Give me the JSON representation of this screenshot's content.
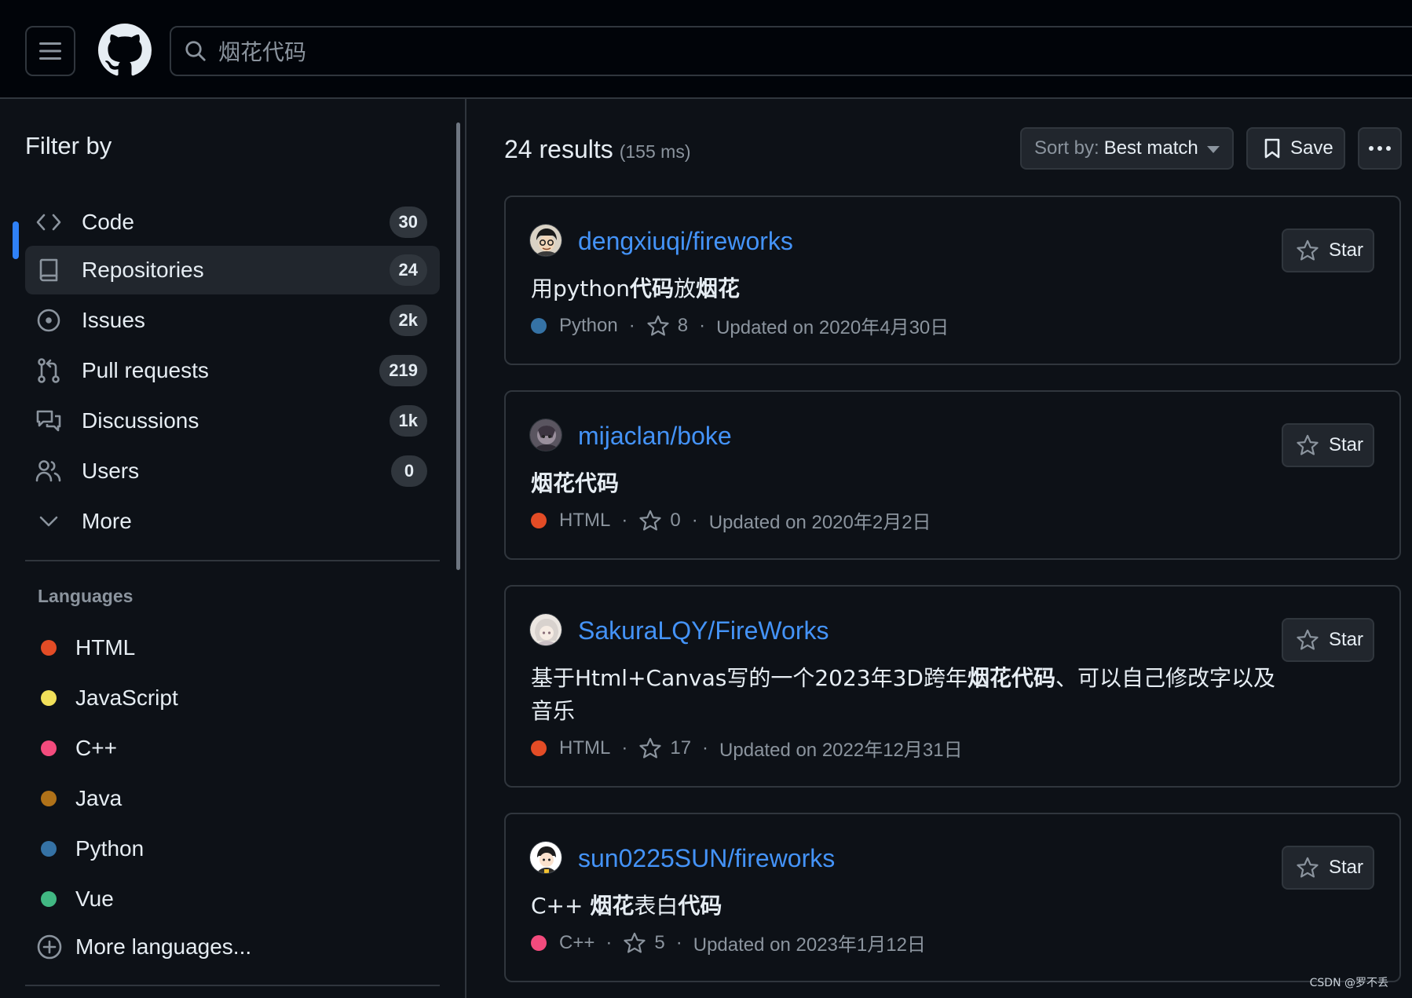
{
  "search": {
    "query": "烟花代码"
  },
  "sidebar": {
    "title": "Filter by",
    "items": [
      {
        "icon": "code-icon",
        "label": "Code",
        "count": "30"
      },
      {
        "icon": "repo-icon",
        "label": "Repositories",
        "count": "24",
        "active": true
      },
      {
        "icon": "issue-icon",
        "label": "Issues",
        "count": "2k"
      },
      {
        "icon": "pull-request-icon",
        "label": "Pull requests",
        "count": "219"
      },
      {
        "icon": "discussion-icon",
        "label": "Discussions",
        "count": "1k"
      },
      {
        "icon": "people-icon",
        "label": "Users",
        "count": "0"
      },
      {
        "icon": "chevron-down-icon",
        "label": "More"
      }
    ],
    "languages_title": "Languages",
    "languages": [
      {
        "label": "HTML",
        "color": "#e34c26"
      },
      {
        "label": "JavaScript",
        "color": "#f1e05a"
      },
      {
        "label": "C++",
        "color": "#f34b7d"
      },
      {
        "label": "Java",
        "color": "#b07219"
      },
      {
        "label": "Python",
        "color": "#3572A5"
      },
      {
        "label": "Vue",
        "color": "#41b883"
      }
    ],
    "more_languages": "More languages..."
  },
  "results": {
    "count": "24 results",
    "time": "(155 ms)",
    "sort_prefix": "Sort by:",
    "sort_value": "Best match",
    "save_label": "Save"
  },
  "repos": [
    {
      "name": "dengxiuqi/fireworks",
      "desc_html": "用python<b>代码</b>放<b>烟花</b>",
      "language": "Python",
      "lang_color": "#3572A5",
      "stars": "8",
      "updated": "Updated on 2020年4月30日",
      "star_label": "Star"
    },
    {
      "name": "mijaclan/boke",
      "desc_html": "<b>烟花代码</b>",
      "language": "HTML",
      "lang_color": "#e34c26",
      "stars": "0",
      "updated": "Updated on 2020年2月2日",
      "star_label": "Star"
    },
    {
      "name": "SakuraLQY/FireWorks",
      "desc_html": "基于Html+Canvas写的一个2023年3D跨年<b>烟花代码</b>、可以自己修改字以及音乐",
      "language": "HTML",
      "lang_color": "#e34c26",
      "stars": "17",
      "updated": "Updated on 2022年12月31日",
      "star_label": "Star"
    },
    {
      "name": "sun0225SUN/fireworks",
      "desc_html": "C++ <b>烟花</b>表白<b>代码</b>",
      "language": "C++",
      "lang_color": "#f34b7d",
      "stars": "5",
      "updated": "Updated on 2023年1月12日",
      "star_label": "Star"
    }
  ],
  "watermark": "CSDN @罗不丢"
}
